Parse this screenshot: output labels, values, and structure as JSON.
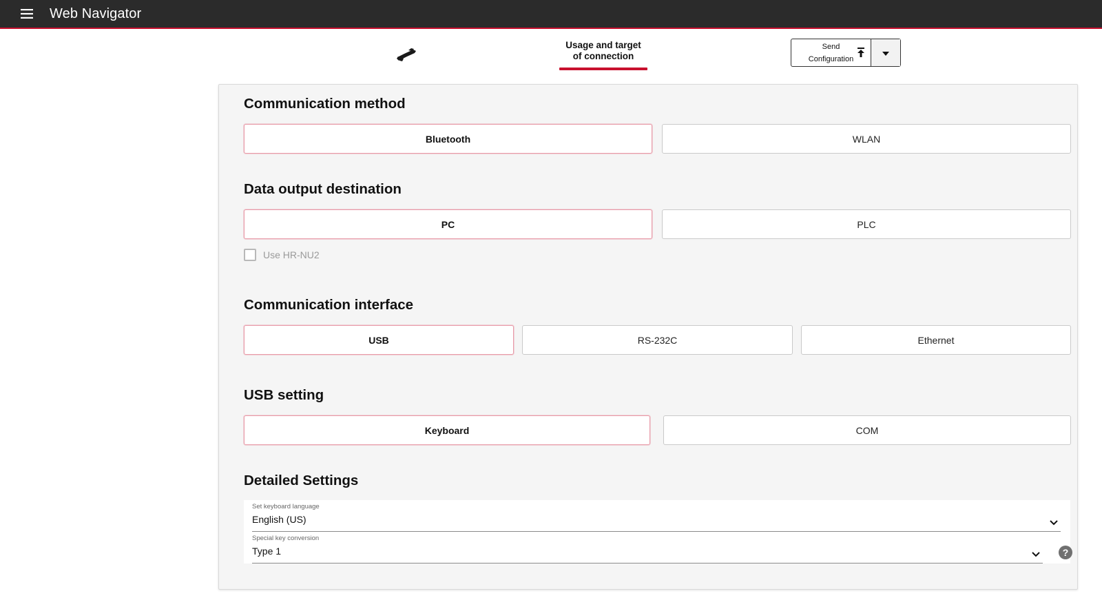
{
  "app": {
    "title": "Web Navigator",
    "accent": "#c8102e",
    "bar_color": "#2b2b2b"
  },
  "header": {
    "menu_icon": "hamburger-menu-icon",
    "device_icon": "barcode-reader-icon",
    "current_step_line1": "Usage and target",
    "current_step_line2": "of connection",
    "send_line1": "Send",
    "send_line2": "Configuration",
    "send_icon": "upload-icon",
    "dropdown_icon": "caret-down-icon"
  },
  "sections": {
    "communication_method": {
      "title": "Communication method",
      "options": [
        "Bluetooth",
        "WLAN"
      ],
      "selected": "Bluetooth"
    },
    "data_output": {
      "title": "Data output destination",
      "options": [
        "PC",
        "PLC"
      ],
      "selected": "PC",
      "checkbox_label": "Use HR-NU2",
      "checkbox_checked": false
    },
    "communication_interface": {
      "title": "Communication interface",
      "options": [
        "USB",
        "RS-232C",
        "Ethernet"
      ],
      "selected": "USB"
    },
    "usb_setting": {
      "title": "USB setting",
      "options": [
        "Keyboard",
        "COM"
      ],
      "selected": "Keyboard"
    },
    "detailed": {
      "title": "Detailed Settings",
      "keyboard_language_label": "Set keyboard language",
      "keyboard_language_value": "English (US)",
      "special_key_label": "Special key conversion",
      "special_key_value": "Type 1",
      "help_icon": "help-circle-icon"
    }
  }
}
